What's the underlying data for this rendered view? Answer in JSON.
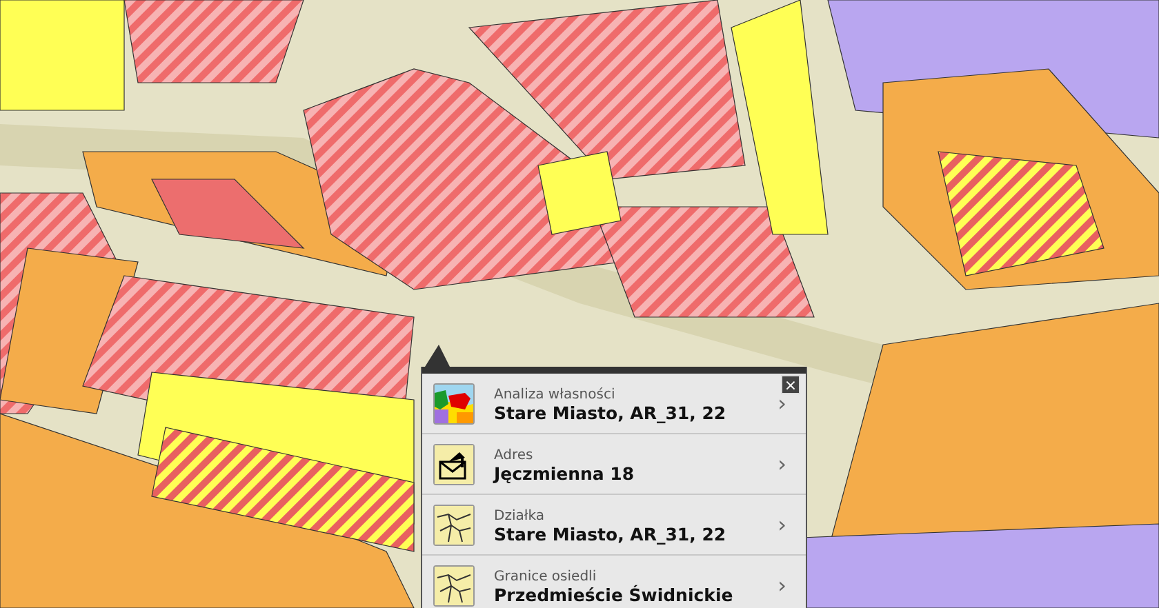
{
  "popup": {
    "close_label": "×",
    "items": [
      {
        "kind": "ownership",
        "label": "Analiza własności",
        "value": "Stare Miasto, AR_31, 22",
        "arrow": "›"
      },
      {
        "kind": "address",
        "label": "Adres",
        "value": "Jęczmienna 18",
        "arrow": "›"
      },
      {
        "kind": "parcel",
        "label": "Działka",
        "value": "Stare Miasto, AR_31, 22",
        "arrow": "›"
      },
      {
        "kind": "parcel",
        "label": "Granice osiedli",
        "value": "Przedmieście Świdnickie",
        "arrow": "›"
      }
    ]
  }
}
